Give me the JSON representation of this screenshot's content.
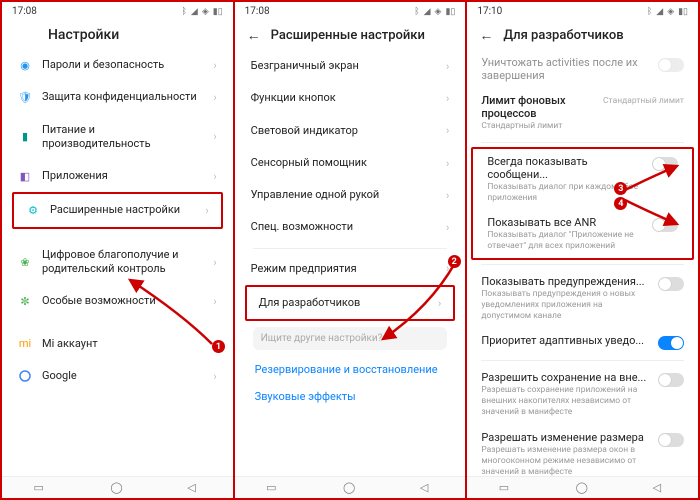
{
  "statusbar": {
    "time1": "17:08",
    "time2": "17:08",
    "time3": "17:10"
  },
  "screen1": {
    "title": "Настройки",
    "items": [
      {
        "icon": "fingerprint",
        "label": "Пароли и безопасность"
      },
      {
        "icon": "shield",
        "label": "Защита конфиденциальности"
      },
      {
        "icon": "battery",
        "label": "Питание и производительность"
      },
      {
        "icon": "apps",
        "label": "Приложения"
      },
      {
        "icon": "settings",
        "label": "Расширенные настройки"
      },
      {
        "icon": "wellbeing",
        "label": "Цифровое благополучие и родительский контроль"
      },
      {
        "icon": "accessibility",
        "label": "Особые возможности"
      },
      {
        "icon": "mi",
        "label": "Mi аккаунт"
      },
      {
        "icon": "google",
        "label": "Google"
      }
    ]
  },
  "screen2": {
    "title": "Расширенные настройки",
    "items": [
      "Безграничный экран",
      "Функции кнопок",
      "Световой индикатор",
      "Сенсорный помощник",
      "Управление одной рукой",
      "Спец. возможности",
      "Режим предприятия",
      "Для разработчиков"
    ],
    "search_placeholder": "Ищите другие настройки?",
    "link1": "Резервирование и восстановление",
    "link2": "Звуковые эффекты"
  },
  "screen3": {
    "title": "Для разработчиков",
    "destroy_label": "Уничтожать activities после их завершения",
    "bg_limit_label": "Лимит фоновых процессов",
    "bg_limit_sub": "Стандартный лимит",
    "bg_limit_value": "Стандартный лимит",
    "crash_label": "Всегда показывать сообщени...",
    "crash_sub": "Показывать диалог при каждом сбое приложения",
    "anr_label": "Показывать все ANR",
    "anr_sub": "Показывать диалог \"Приложение не отвечает\" для всех приложений",
    "warn_label": "Показывать предупреждения...",
    "warn_sub": "Показывать предупреждения о новых уведомлениях приложения на допустимом канале",
    "adaptive_label": "Приоритет адаптивных уведо...",
    "ext_label": "Разрешить сохранение на вне...",
    "ext_sub": "Разрешать сохранение приложений на внешних накопителях независимо от значений в манифесте",
    "resize_label": "Разрешать изменение размера",
    "resize_sub": "Разрешать изменение размера окон в многооконном режиме независимо от значений в манифесте"
  },
  "callouts": {
    "c1": "1",
    "c2": "2",
    "c3": "3",
    "c4": "4"
  }
}
